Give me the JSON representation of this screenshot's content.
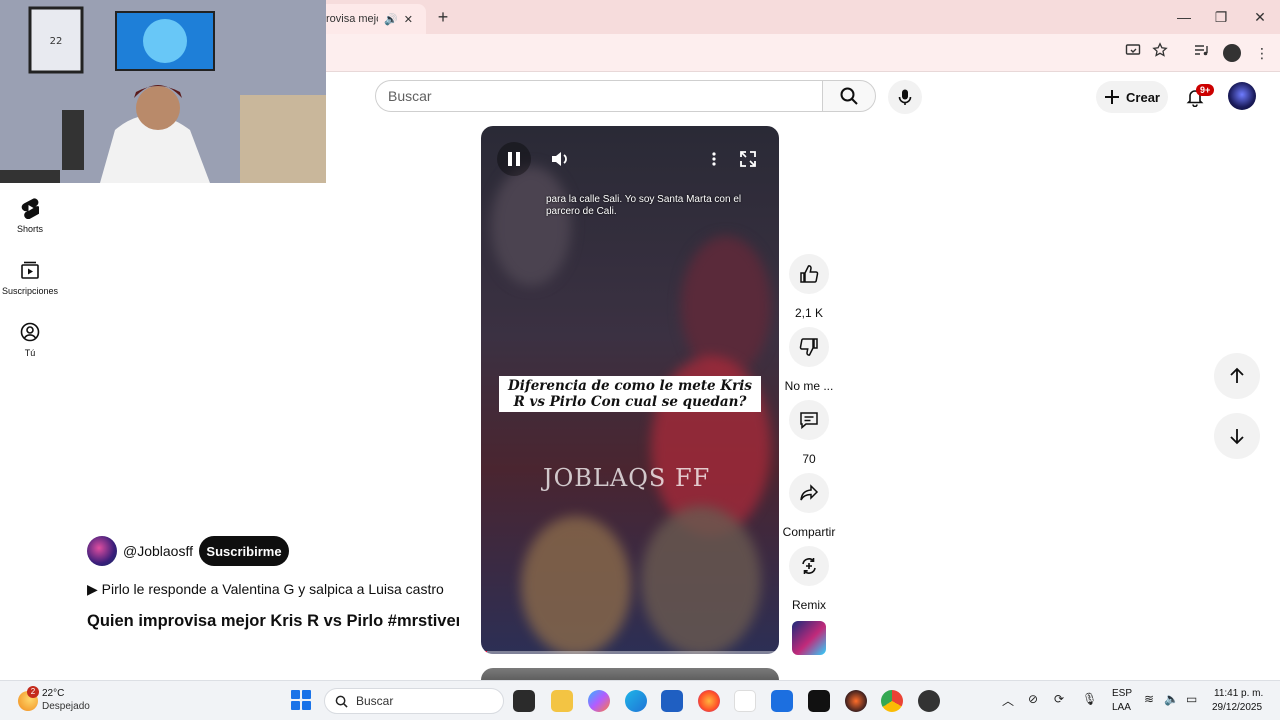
{
  "browser": {
    "active_tab_title": "rovisa mejor",
    "new_tab_symbol": "+",
    "close_tab_symbol": "✕",
    "window_controls": {
      "minimize": "—",
      "restore": "❐",
      "close": "✕"
    }
  },
  "header": {
    "search_placeholder": "Buscar",
    "create_label": "Crear",
    "notification_count": "9+"
  },
  "sidebar": {
    "items": [
      {
        "label": "Shorts",
        "icon": "shorts-icon"
      },
      {
        "label": "Suscripciones",
        "icon": "subscriptions-icon"
      },
      {
        "label": "Tú",
        "icon": "you-icon"
      }
    ]
  },
  "video": {
    "subtitle": "para la calle Sali. Yo soy Santa Marta con el parcero de Cali.",
    "caption": "Diferencia de como le mete Kris R vs Pirlo Con cual se quedan?",
    "watermark": "JOBLAQS FF",
    "progress": 0.02,
    "progress_color": "#ff0033"
  },
  "actions": {
    "like_count": "2,1 K",
    "dislike_label": "No me ...",
    "comment_count": "70",
    "share_label": "Compartir",
    "remix_label": "Remix"
  },
  "channel": {
    "handle": "@Joblaosff",
    "subscribe_label": "Suscribirme",
    "playlist_link": "▶ Pirlo le responde a Valentina G y salpica a Luisa castro",
    "short_title": "Quien improvisa mejor Kris R vs Pirlo #mrstiven…"
  },
  "taskbar": {
    "weather_temp": "22°C",
    "weather_desc": "Despejado",
    "weather_badge": "2",
    "search_label": "Buscar",
    "lang_line1": "ESP",
    "lang_line2": "LAA",
    "time": "11:41 p. m.",
    "date": "29/12/2025"
  },
  "colors": {
    "accent_red": "#cc0000",
    "subscribe_bg": "#0f0f0f",
    "chrome_tab_bg": "#f6dcdc"
  }
}
